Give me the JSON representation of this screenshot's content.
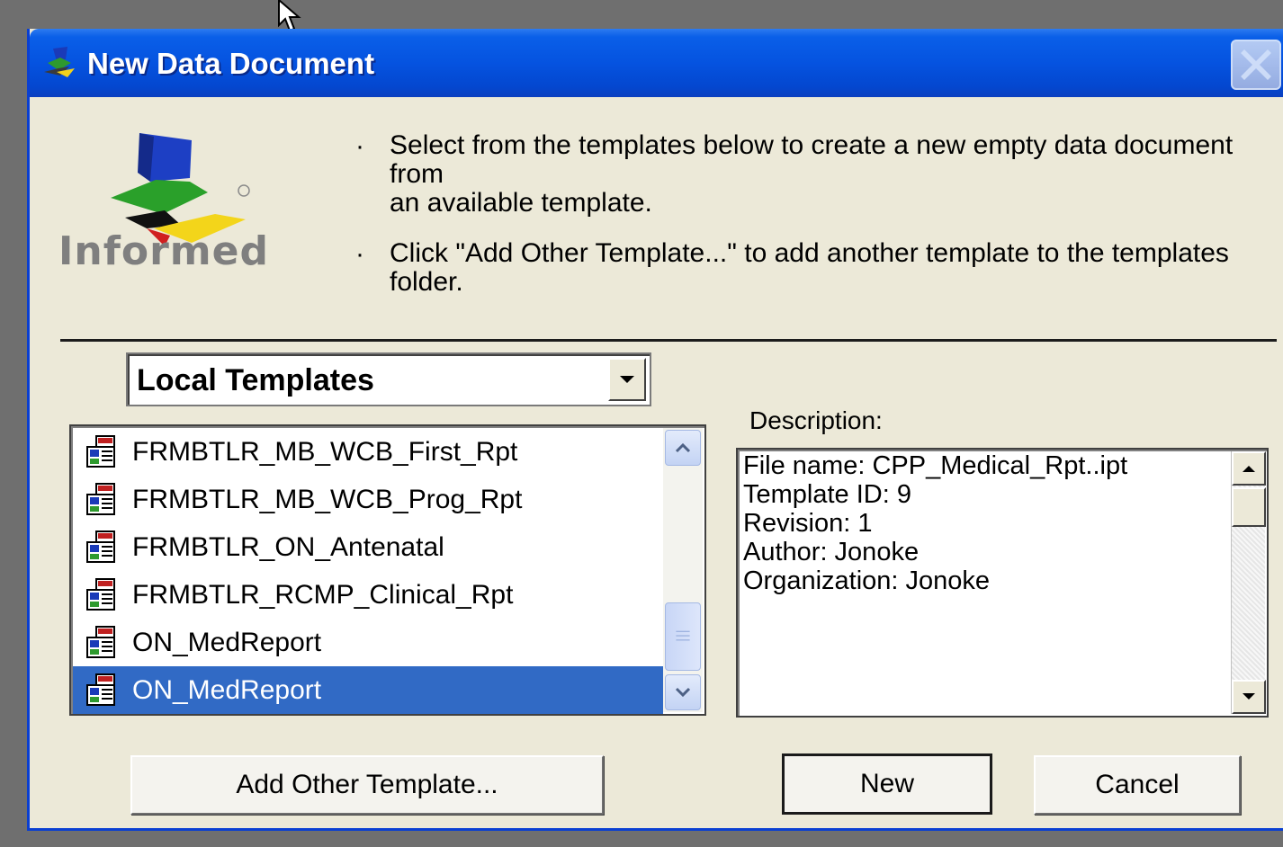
{
  "window": {
    "title": "New Data Document"
  },
  "logo": {
    "brand_text": "Informed"
  },
  "instructions": [
    {
      "line1": "Select from the templates below to create a new empty data document from",
      "line2": "an available template."
    },
    {
      "line1": "Click \"Add Other Template...\" to add another template to the templates",
      "line2": "folder."
    }
  ],
  "template_source": {
    "selected": "Local Templates"
  },
  "templates": {
    "items": [
      "FRMBTLR_MB_WCB_First_Rpt",
      "FRMBTLR_MB_WCB_Prog_Rpt",
      "FRMBTLR_ON_Antenatal",
      "FRMBTLR_RCMP_Clinical_Rpt",
      "ON_MedReport",
      "ON_MedReport"
    ],
    "selected_index": 5
  },
  "description": {
    "label": "Description:",
    "lines": [
      "File name: CPP_Medical_Rpt..ipt",
      "Template ID: 9",
      "Revision: 1",
      "Author: Jonoke",
      "Organization: Jonoke"
    ]
  },
  "buttons": {
    "add_other": "Add Other Template...",
    "new": "New",
    "cancel": "Cancel"
  },
  "colors": {
    "titlebar": "#0553e0",
    "selection": "#316ac5",
    "dialog_bg": "#ece9d8"
  }
}
